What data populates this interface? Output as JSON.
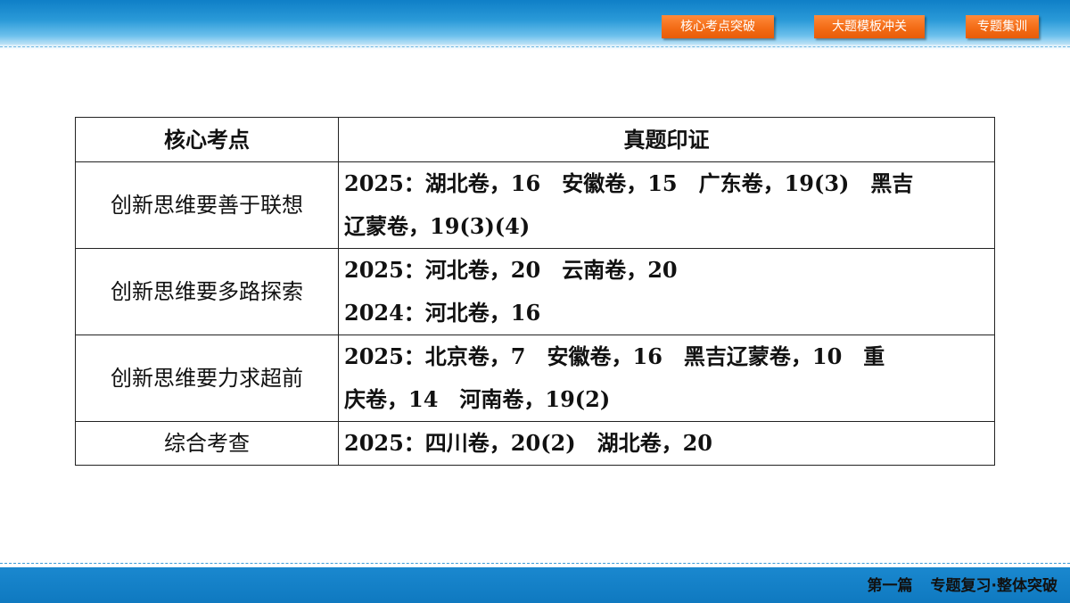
{
  "nav": {
    "buttons": [
      "核心考点突破",
      "大题模板冲关",
      "专题集训"
    ]
  },
  "table": {
    "headers": [
      "核心考点",
      "真题印证"
    ],
    "rows": [
      {
        "topic": "创新思维要善于联想",
        "lines": [
          "2025：湖北卷，16　安徽卷，15　广东卷，19(3)　黑吉",
          "辽蒙卷，19(3)(4)"
        ]
      },
      {
        "topic": "创新思维要多路探索",
        "lines": [
          "2025：河北卷，20　云南卷，20",
          "2024：河北卷，16"
        ]
      },
      {
        "topic": "创新思维要力求超前",
        "lines": [
          "2025：北京卷，7　安徽卷，16　黑吉辽蒙卷，10　重",
          "庆卷，14　河南卷，19(2)"
        ]
      },
      {
        "topic": "综合考查",
        "lines": [
          "2025：四川卷，20(2)　湖北卷，20"
        ]
      }
    ]
  },
  "footer": {
    "part": "第一篇",
    "title": "专题复习·整体突破"
  },
  "colors": {
    "banner": "#1a88cf",
    "button": "#f26a14",
    "border": "#222222"
  }
}
